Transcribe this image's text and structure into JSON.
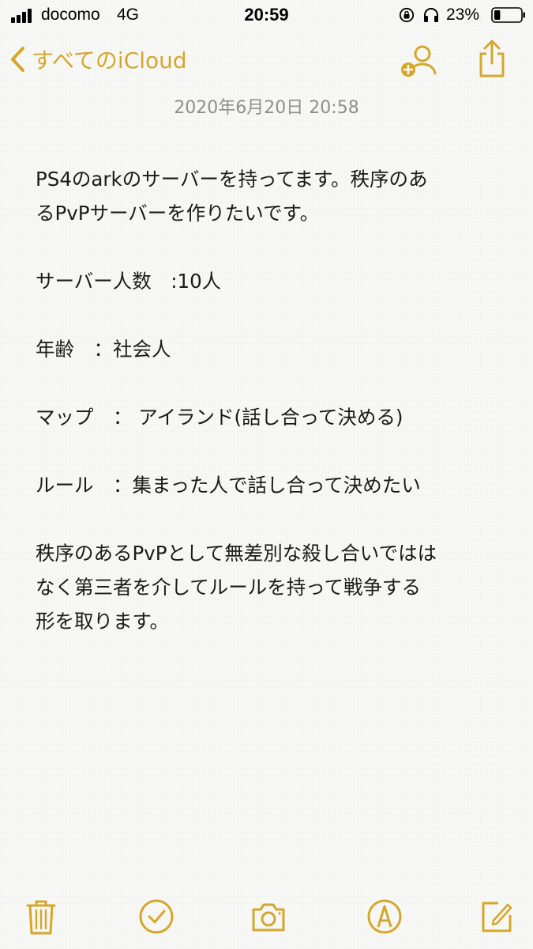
{
  "status_bar": {
    "carrier": "docomo",
    "network": "4G",
    "time": "20:59",
    "battery_percent": "23%",
    "battery_level": 0.23,
    "signal_bars": 4,
    "icons": [
      "signal-icon",
      "lock-rotation-icon",
      "headphones-icon",
      "battery-icon"
    ]
  },
  "nav": {
    "back_label": "すべてのiCloud",
    "icons": [
      "chevron-left-icon",
      "add-person-icon",
      "share-icon"
    ]
  },
  "note": {
    "timestamp": "2020年6月20日 20:58",
    "lines": [
      "PS4のarkのサーバーを持ってます。秩序のあ",
      "るPvPサーバーを作りたいです。",
      "",
      "サーバー人数　:10人",
      "",
      "年齢　：社会人",
      "",
      "マップ　：  アイランド(話し合って決める)",
      "",
      "ルール　：集まった人で話し合って決めたい",
      "",
      "秩序のあるPvPとして無差別な殺し合いではは",
      "なく第三者を介してルールを持って戦争する",
      "形を取ります。"
    ]
  },
  "toolbar": {
    "icons": [
      "trash-icon",
      "checklist-icon",
      "camera-icon",
      "markup-icon",
      "compose-icon"
    ]
  },
  "colors": {
    "accent": "#d4a72c",
    "background": "#f8f8f6",
    "text": "#1a1a1a",
    "timestamp": "#8e8e8e"
  }
}
